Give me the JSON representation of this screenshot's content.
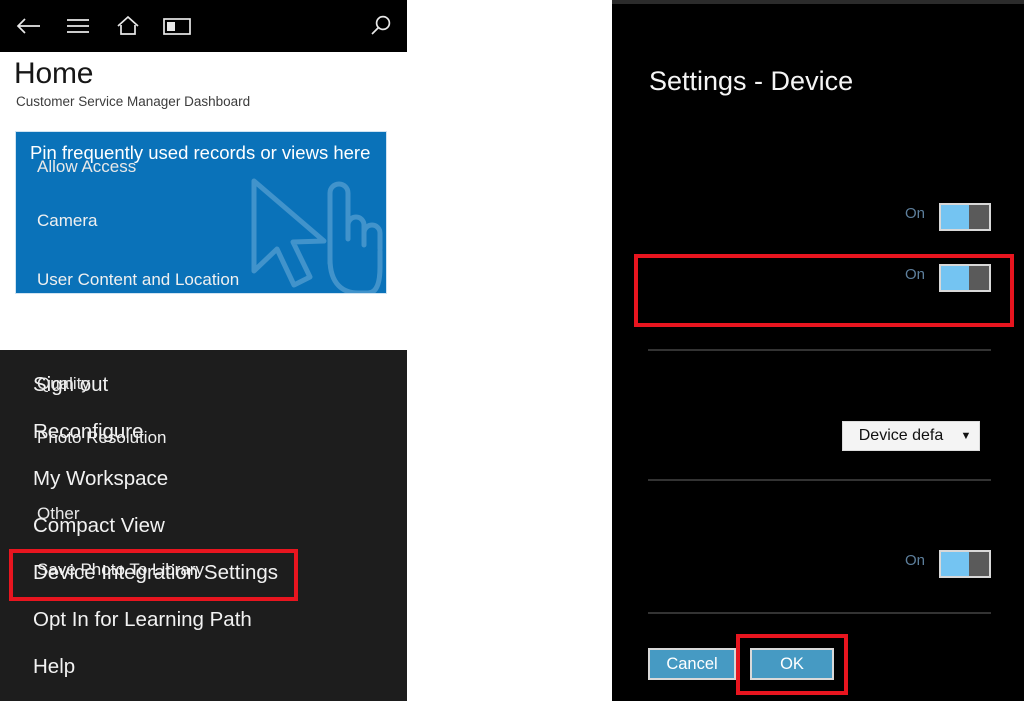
{
  "left_panel": {
    "toolbar": {
      "back_icon": "back-arrow-icon",
      "menu_icon": "hamburger-menu-icon",
      "home_icon": "home-icon",
      "panel_icon": "side-panel-icon",
      "search_icon": "search-icon"
    },
    "header": {
      "title": "Home",
      "subtitle": "Customer Service Manager Dashboard"
    },
    "pin_tile": {
      "text": "Pin frequently used records or views here",
      "background_color": "#0a72b9",
      "glyph": "tap-gesture-icon"
    },
    "menu": {
      "items": [
        {
          "label": "Sign out"
        },
        {
          "label": "Reconfigure"
        },
        {
          "label": "My Workspace"
        },
        {
          "label": "Compact View"
        },
        {
          "label": "Device Integration Settings"
        },
        {
          "label": "Opt In for Learning Path"
        },
        {
          "label": "Help"
        }
      ],
      "highlighted_item": "Device Integration Settings",
      "background_color": "#1d1d1d"
    }
  },
  "right_panel": {
    "title": "Settings - Device",
    "background_color": "#000000",
    "sections": [
      {
        "label": "Allow Access",
        "rows": [
          {
            "label": "Camera",
            "state": "On",
            "control": "toggle"
          },
          {
            "label": "User Content and Location",
            "state": "On",
            "control": "toggle"
          }
        ]
      },
      {
        "label": "Quality",
        "rows": [
          {
            "label": "Photo Resolution",
            "control": "dropdown",
            "value": "Device defa"
          }
        ]
      },
      {
        "label": "Other",
        "rows": [
          {
            "label": "Save Photo To Library",
            "state": "On",
            "control": "toggle"
          }
        ]
      }
    ],
    "buttons": {
      "cancel": "Cancel",
      "ok": "OK",
      "button_color": "#469ac3"
    },
    "toggle_on_color": "#74c4f2",
    "toggle_off_color": "#5a5a5a",
    "state_label_color": "#5d7f9c",
    "highlighted_rows": [
      "User Content and Location",
      "OK"
    ]
  },
  "annotations": {
    "highlight_color": "#e8151f",
    "boxes": [
      {
        "target": "Device Integration Settings"
      },
      {
        "target": "User Content and Location"
      },
      {
        "target": "OK"
      }
    ]
  }
}
